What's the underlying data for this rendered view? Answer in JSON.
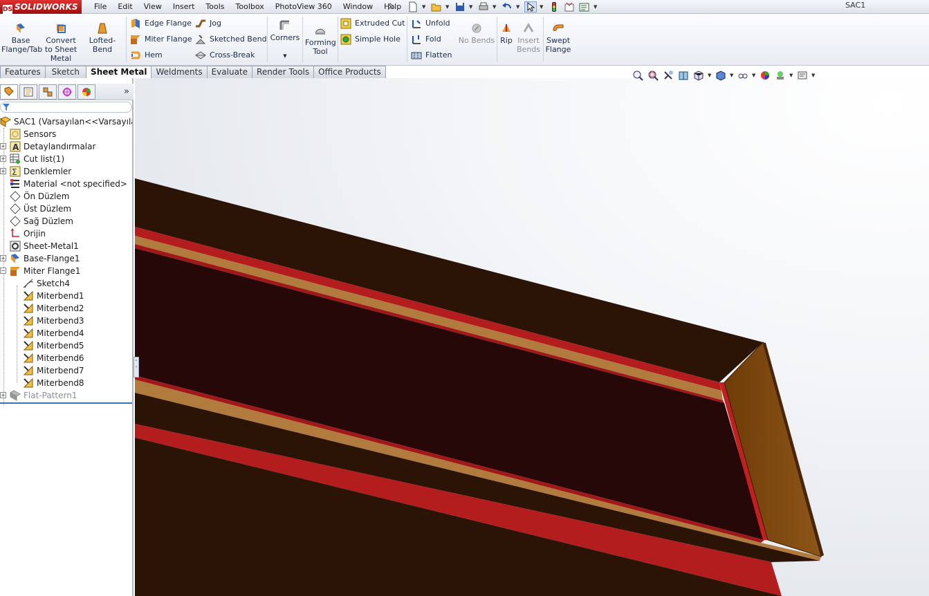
{
  "app": {
    "logo": "SOLIDWORKS",
    "logo_mark": "DS",
    "document_title": "SAC1"
  },
  "menu": [
    "File",
    "Edit",
    "View",
    "Insert",
    "Tools",
    "Toolbox",
    "PhotoView 360",
    "Window",
    "Help"
  ],
  "ribbon": {
    "base_flange": "Base\nFlange/Tab",
    "convert": "Convert\nto Sheet\nMetal",
    "lofted_bend": "Lofted-Bend",
    "edge_flange": "Edge Flange",
    "miter_flange": "Miter Flange",
    "hem": "Hem",
    "jog": "Jog",
    "sketched_bend": "Sketched Bend",
    "cross_break": "Cross-Break",
    "corners": "Corners",
    "forming_tool": "Forming\nTool",
    "extruded_cut": "Extruded Cut",
    "simple_hole": "Simple Hole",
    "unfold": "Unfold",
    "fold": "Fold",
    "flatten": "Flatten",
    "no_bends": "No Bends",
    "rip": "Rip",
    "insert_bends": "Insert\nBends",
    "swept_flange": "Swept\nFlange"
  },
  "tabs": [
    {
      "label": "Features",
      "active": false
    },
    {
      "label": "Sketch",
      "active": false
    },
    {
      "label": "Sheet Metal",
      "active": true
    },
    {
      "label": "Weldments",
      "active": false
    },
    {
      "label": "Evaluate",
      "active": false
    },
    {
      "label": "Render Tools",
      "active": false
    },
    {
      "label": "Office Products",
      "active": false
    }
  ],
  "tree": {
    "root": "SAC1  (Varsayılan<<Varsayılan>_G",
    "items": [
      {
        "label": "Sensors",
        "icon": "sensor-icon"
      },
      {
        "label": "Detaylandırmalar",
        "icon": "annotations-icon"
      },
      {
        "label": "Cut list(1)",
        "icon": "cut-list-icon"
      },
      {
        "label": "Denklemler",
        "icon": "equations-icon"
      },
      {
        "label": "Material <not specified>",
        "icon": "material-icon"
      },
      {
        "label": "Ön Düzlem",
        "icon": "plane-icon"
      },
      {
        "label": "Üst Düzlem",
        "icon": "plane-icon"
      },
      {
        "label": "Sağ Düzlem",
        "icon": "plane-icon"
      },
      {
        "label": "Orijin",
        "icon": "origin-icon"
      },
      {
        "label": "Sheet-Metal1",
        "icon": "sheet-metal-icon"
      },
      {
        "label": "Base-Flange1",
        "icon": "base-flange-icon"
      },
      {
        "label": "Miter Flange1",
        "icon": "miter-flange-icon"
      },
      {
        "label": "Sketch4",
        "icon": "sketch-icon"
      },
      {
        "label": "Miterbend1",
        "icon": "bend-icon"
      },
      {
        "label": "Miterbend2",
        "icon": "bend-icon"
      },
      {
        "label": "Miterbend3",
        "icon": "bend-icon"
      },
      {
        "label": "Miterbend4",
        "icon": "bend-icon"
      },
      {
        "label": "Miterbend5",
        "icon": "bend-icon"
      },
      {
        "label": "Miterbend6",
        "icon": "bend-icon"
      },
      {
        "label": "Miterbend7",
        "icon": "bend-icon"
      },
      {
        "label": "Miterbend8",
        "icon": "bend-icon"
      },
      {
        "label": "Flat-Pattern1",
        "icon": "flat-pattern-icon"
      }
    ]
  },
  "colors": {
    "dark_face": "#2b1405",
    "inner_face": "#250808",
    "red_edge": "#b01818",
    "tan_strip": "#b07a3c",
    "flange": "#7e4710"
  }
}
